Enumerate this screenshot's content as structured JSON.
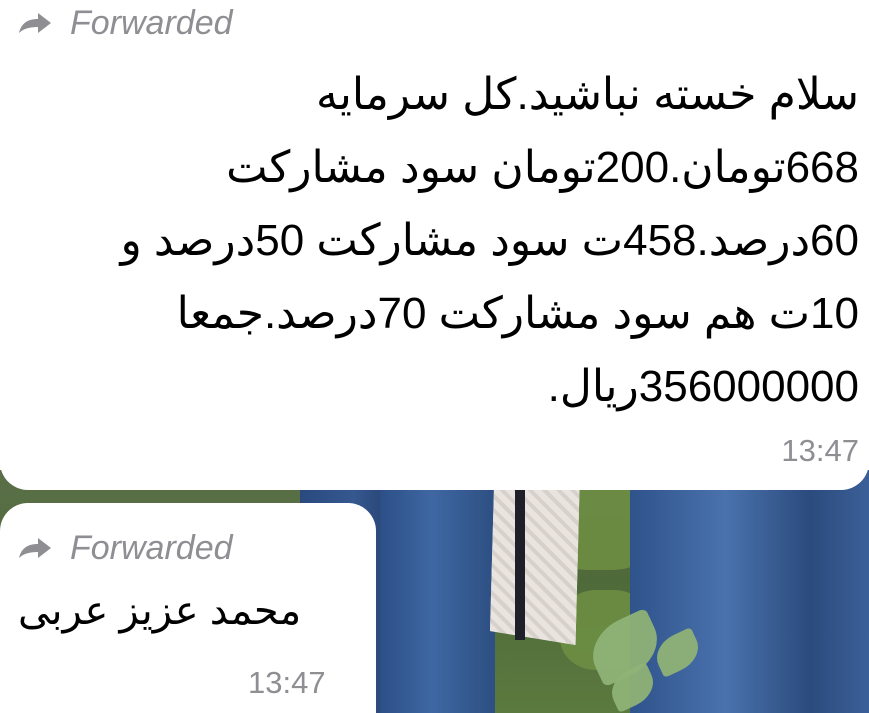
{
  "messages": [
    {
      "forwarded_label": "Forwarded",
      "lines": [
        "سلام خسته نباشید.کل سرمایه",
        "668تومان.200تومان سود مشارکت",
        "60درصد.458ت سود مشارکت 50درصد و",
        "10ت هم سود مشارکت 70درصد.جمعا",
        "356000000ریال."
      ],
      "time": "13:47"
    },
    {
      "forwarded_label": "Forwarded",
      "text": "محمد عزیز عربی",
      "time": "13:47"
    }
  ],
  "icons": {
    "forward": "forward-arrow-icon"
  },
  "colors": {
    "bubble": "#ffffff",
    "meta_text": "#8e8e93",
    "message_text": "#000000"
  }
}
